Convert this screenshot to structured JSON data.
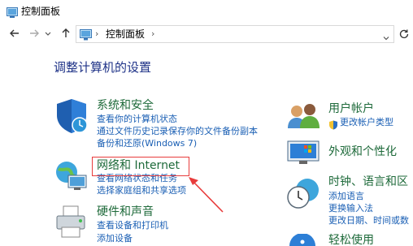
{
  "window": {
    "title": "控制面板"
  },
  "address": {
    "crumb": "控制面板",
    "sep": "›"
  },
  "page": {
    "title": "调整计算机的设置"
  },
  "categories": {
    "security": {
      "title": "系统和安全",
      "links": [
        "查看你的计算机状态",
        "通过文件历史记录保存你的文件备份副本",
        "备份和还原(Windows 7)"
      ]
    },
    "network": {
      "title": "网络和 Internet",
      "links": [
        "查看网络状态和任务",
        "选择家庭组和共享选项"
      ]
    },
    "hardware": {
      "title": "硬件和声音",
      "links": [
        "查看设备和打印机",
        "添加设备"
      ]
    },
    "user": {
      "title": "用户帐户",
      "links": [
        "更改帐户类型"
      ]
    },
    "appearance": {
      "title": "外观和个性化",
      "links": []
    },
    "clock": {
      "title": "时钟、语言和区",
      "links": [
        "添加语言",
        "更换输入法",
        "更改日期、时间或数"
      ]
    },
    "ease": {
      "title": "轻松使用",
      "links": []
    }
  },
  "colors": {
    "accent_link": "#1a5fb4",
    "category_heading": "#1e6a3a",
    "title": "#1e3287",
    "highlight": "#e83c3c"
  },
  "icons": {
    "back": "arrow-left-icon",
    "forward": "arrow-right-icon",
    "recent": "chevron-down-icon",
    "up": "arrow-up-icon",
    "refresh": "refresh-icon"
  }
}
